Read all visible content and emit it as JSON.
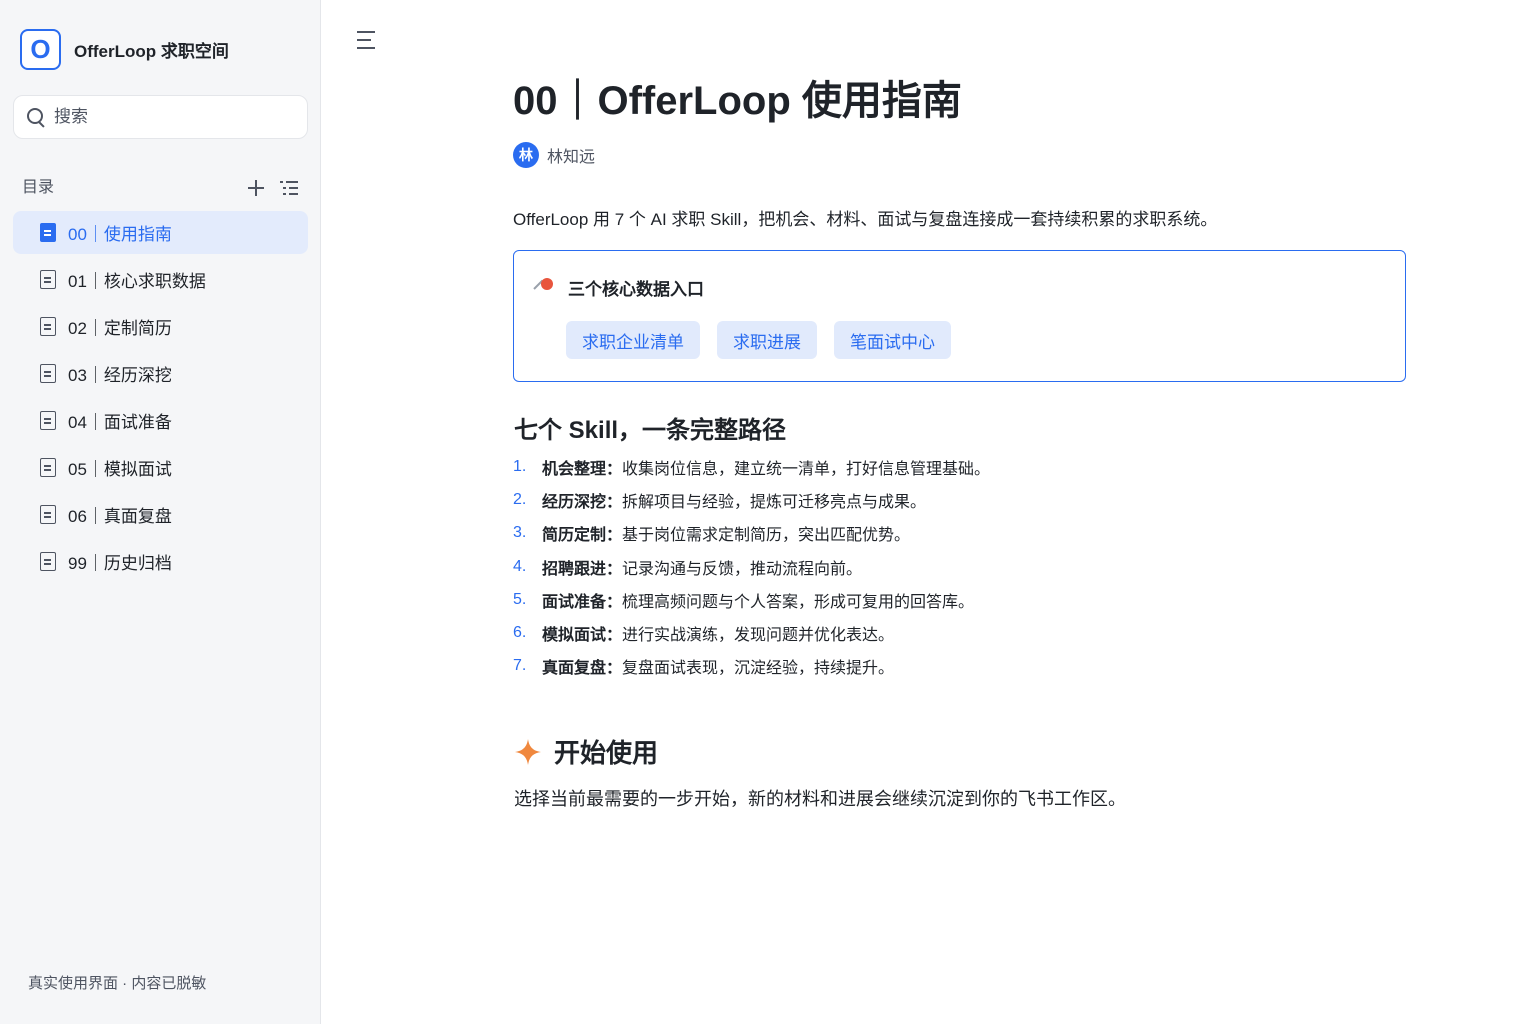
{
  "brand": {
    "logo_letter": "O",
    "name": "OfferLoop 求职空间"
  },
  "search": {
    "placeholder": "搜索"
  },
  "toc": {
    "title": "目录"
  },
  "nav": [
    {
      "label": "00｜使用指南",
      "active": true
    },
    {
      "label": "01｜核心求职数据",
      "active": false
    },
    {
      "label": "02｜定制简历",
      "active": false
    },
    {
      "label": "03｜经历深挖",
      "active": false
    },
    {
      "label": "04｜面试准备",
      "active": false
    },
    {
      "label": "05｜模拟面试",
      "active": false
    },
    {
      "label": "06｜真面复盘",
      "active": false
    },
    {
      "label": "99｜历史归档",
      "active": false
    }
  ],
  "sidebar_footer": "真实使用界面 · 内容已脱敏",
  "doc": {
    "title": "00｜OfferLoop 使用指南",
    "author_initial": "林",
    "author_name": "林知远",
    "intro": "OfferLoop 用 7 个 AI 求职 Skill，把机会、材料、面试与复盘连接成一套持续积累的求职系统。",
    "callout": {
      "title": "三个核心数据入口",
      "chips": [
        "求职企业清单",
        "求职进展",
        "笔面试中心"
      ]
    },
    "section_title": "七个 Skill，一条完整路径",
    "skills": [
      {
        "num": "1.",
        "name": "机会整理：",
        "desc": "收集岗位信息，建立统一清单，打好信息管理基础。"
      },
      {
        "num": "2.",
        "name": "经历深挖：",
        "desc": "拆解项目与经验，提炼可迁移亮点与成果。"
      },
      {
        "num": "3.",
        "name": "简历定制：",
        "desc": "基于岗位需求定制简历，突出匹配优势。"
      },
      {
        "num": "4.",
        "name": "招聘跟进：",
        "desc": "记录沟通与反馈，推动流程向前。"
      },
      {
        "num": "5.",
        "name": "面试准备：",
        "desc": "梳理高频问题与个人答案，形成可复用的回答库。"
      },
      {
        "num": "6.",
        "name": "模拟面试：",
        "desc": "进行实战演练，发现问题并优化表达。"
      },
      {
        "num": "7.",
        "name": "真面复盘：",
        "desc": "复盘面试表现，沉淀经验，持续提升。"
      }
    ],
    "start_title": "开始使用",
    "start_desc": "选择当前最需要的一步开始，新的材料和进展会继续沉淀到你的飞书工作区。"
  },
  "colors": {
    "accent": "#2a6cf0",
    "sparkle": "#f0883e",
    "pin": "#e8553d"
  }
}
